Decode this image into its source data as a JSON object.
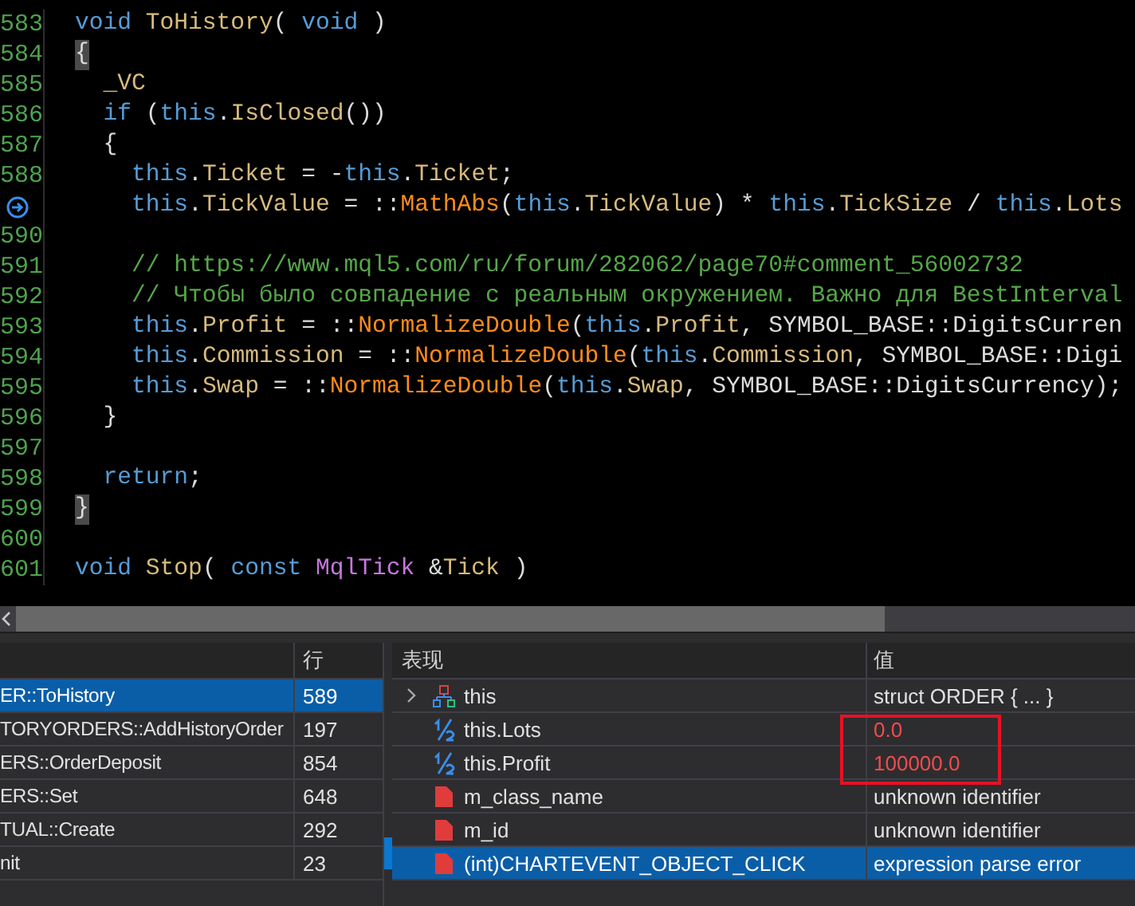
{
  "editor": {
    "lines": [
      {
        "number": "583",
        "current": false,
        "tokens": [
          {
            "kind": "keyword",
            "text": "void "
          },
          {
            "kind": "member",
            "text": "ToHistory"
          },
          {
            "kind": "plain",
            "text": "( "
          },
          {
            "kind": "keyword",
            "text": "void"
          },
          {
            "kind": "plain",
            "text": " )"
          }
        ]
      },
      {
        "number": "584",
        "current": false,
        "tokens": [
          {
            "kind": "brace",
            "text": "{"
          }
        ]
      },
      {
        "number": "585",
        "current": false,
        "tokens": [
          {
            "kind": "member",
            "text": "  _VC"
          }
        ]
      },
      {
        "number": "586",
        "current": false,
        "tokens": [
          {
            "kind": "keyword",
            "text": "  if"
          },
          {
            "kind": "plain",
            "text": " ("
          },
          {
            "kind": "keyword",
            "text": "this"
          },
          {
            "kind": "plain",
            "text": "."
          },
          {
            "kind": "member",
            "text": "IsClosed"
          },
          {
            "kind": "plain",
            "text": "())"
          }
        ]
      },
      {
        "number": "587",
        "current": false,
        "tokens": [
          {
            "kind": "plain",
            "text": "  {"
          }
        ]
      },
      {
        "number": "588",
        "current": false,
        "tokens": [
          {
            "kind": "keyword",
            "text": "    this"
          },
          {
            "kind": "plain",
            "text": "."
          },
          {
            "kind": "member",
            "text": "Ticket"
          },
          {
            "kind": "plain",
            "text": " = -"
          },
          {
            "kind": "keyword",
            "text": "this"
          },
          {
            "kind": "plain",
            "text": "."
          },
          {
            "kind": "member",
            "text": "Ticket"
          },
          {
            "kind": "plain",
            "text": ";"
          }
        ]
      },
      {
        "current": true,
        "tokens": [
          {
            "kind": "keyword",
            "text": "    this"
          },
          {
            "kind": "plain",
            "text": "."
          },
          {
            "kind": "member",
            "text": "TickValue"
          },
          {
            "kind": "plain",
            "text": " = ::"
          },
          {
            "kind": "function",
            "text": "MathAbs"
          },
          {
            "kind": "plain",
            "text": "("
          },
          {
            "kind": "keyword",
            "text": "this"
          },
          {
            "kind": "plain",
            "text": "."
          },
          {
            "kind": "member",
            "text": "TickValue"
          },
          {
            "kind": "plain",
            "text": ") * "
          },
          {
            "kind": "keyword",
            "text": "this"
          },
          {
            "kind": "plain",
            "text": "."
          },
          {
            "kind": "member",
            "text": "TickSize"
          },
          {
            "kind": "plain",
            "text": " / "
          },
          {
            "kind": "keyword",
            "text": "this"
          },
          {
            "kind": "plain",
            "text": "."
          },
          {
            "kind": "member",
            "text": "Lots"
          }
        ]
      },
      {
        "number": "590",
        "current": false
      },
      {
        "number": "591",
        "current": false,
        "tokens": [
          {
            "kind": "comment",
            "text": "    // https://www.mql5.com/ru/forum/282062/page70#comment_56002732"
          }
        ]
      },
      {
        "number": "592",
        "current": false,
        "tokens": [
          {
            "kind": "comment",
            "text": "    // Чтобы было совпадение с реальным окружением. Важно для BestInterval"
          }
        ]
      },
      {
        "number": "593",
        "current": false,
        "tokens": [
          {
            "kind": "keyword",
            "text": "    this"
          },
          {
            "kind": "plain",
            "text": "."
          },
          {
            "kind": "member",
            "text": "Profit"
          },
          {
            "kind": "plain",
            "text": " = ::"
          },
          {
            "kind": "function",
            "text": "NormalizeDouble"
          },
          {
            "kind": "plain",
            "text": "("
          },
          {
            "kind": "keyword",
            "text": "this"
          },
          {
            "kind": "plain",
            "text": "."
          },
          {
            "kind": "member",
            "text": "Profit"
          },
          {
            "kind": "plain",
            "text": ", SYMBOL_BASE::DigitsCurren"
          }
        ]
      },
      {
        "number": "594",
        "current": false,
        "tokens": [
          {
            "kind": "keyword",
            "text": "    this"
          },
          {
            "kind": "plain",
            "text": "."
          },
          {
            "kind": "member",
            "text": "Commission"
          },
          {
            "kind": "plain",
            "text": " = ::"
          },
          {
            "kind": "function",
            "text": "NormalizeDouble"
          },
          {
            "kind": "plain",
            "text": "("
          },
          {
            "kind": "keyword",
            "text": "this"
          },
          {
            "kind": "plain",
            "text": "."
          },
          {
            "kind": "member",
            "text": "Commission"
          },
          {
            "kind": "plain",
            "text": ", SYMBOL_BASE::Digi"
          }
        ]
      },
      {
        "number": "595",
        "current": false,
        "tokens": [
          {
            "kind": "keyword",
            "text": "    this"
          },
          {
            "kind": "plain",
            "text": "."
          },
          {
            "kind": "member",
            "text": "Swap"
          },
          {
            "kind": "plain",
            "text": " = ::"
          },
          {
            "kind": "function",
            "text": "NormalizeDouble"
          },
          {
            "kind": "plain",
            "text": "("
          },
          {
            "kind": "keyword",
            "text": "this"
          },
          {
            "kind": "plain",
            "text": "."
          },
          {
            "kind": "member",
            "text": "Swap"
          },
          {
            "kind": "plain",
            "text": ", SYMBOL_BASE::DigitsCurrency);"
          }
        ]
      },
      {
        "number": "596",
        "current": false,
        "tokens": [
          {
            "kind": "plain",
            "text": "  }"
          }
        ]
      },
      {
        "number": "597",
        "current": false
      },
      {
        "number": "598",
        "current": false,
        "tokens": [
          {
            "kind": "keyword",
            "text": "  return"
          },
          {
            "kind": "plain",
            "text": ";"
          }
        ]
      },
      {
        "number": "599",
        "current": false,
        "tokens": [
          {
            "kind": "brace",
            "text": "}"
          }
        ]
      },
      {
        "number": "600",
        "current": false
      },
      {
        "number": "601",
        "current": false,
        "tokens": [
          {
            "kind": "keyword",
            "text": "void "
          },
          {
            "kind": "member",
            "text": "Stop"
          },
          {
            "kind": "plain",
            "text": "( "
          },
          {
            "kind": "keyword",
            "text": "const "
          },
          {
            "kind": "type",
            "text": "MqlTick"
          },
          {
            "kind": "plain",
            "text": " &"
          },
          {
            "kind": "member",
            "text": "Tick"
          },
          {
            "kind": "plain",
            "text": " )"
          }
        ]
      }
    ]
  },
  "call_stack": {
    "columns": [
      "行"
    ],
    "rows": [
      {
        "function": "ER::ToHistory",
        "line": "589",
        "selected": true
      },
      {
        "function": "TORYORDERS::AddHistoryOrder",
        "line": "197",
        "selected": false
      },
      {
        "function": "ERS::OrderDeposit",
        "line": "854",
        "selected": false
      },
      {
        "function": "ERS::Set",
        "line": "648",
        "selected": false
      },
      {
        "function": "TUAL::Create",
        "line": "292",
        "selected": false
      },
      {
        "function": "nit",
        "line": "23",
        "selected": false
      }
    ]
  },
  "watch": {
    "columns": [
      "表现",
      "值"
    ],
    "rows": [
      {
        "kind": "struct",
        "expandable": true,
        "expression": "this",
        "value": "struct ORDER { ... }",
        "changed": false,
        "highlighted": false,
        "selected": false
      },
      {
        "kind": "number",
        "expandable": false,
        "expression": "this.Lots",
        "value": "0.0",
        "changed": true,
        "highlighted": true,
        "selected": false
      },
      {
        "kind": "number",
        "expandable": false,
        "expression": "this.Profit",
        "value": "100000.0",
        "changed": true,
        "highlighted": true,
        "selected": false
      },
      {
        "kind": "error",
        "expandable": false,
        "expression": "m_class_name",
        "value": "unknown identifier",
        "changed": false,
        "highlighted": false,
        "selected": false
      },
      {
        "kind": "error",
        "expandable": false,
        "expression": "m_id",
        "value": "unknown identifier",
        "changed": false,
        "highlighted": false,
        "selected": false
      },
      {
        "kind": "error",
        "expandable": false,
        "expression": "(int)CHARTEVENT_OBJECT_CLICK",
        "value": "expression parse error",
        "changed": false,
        "highlighted": false,
        "selected": true
      }
    ]
  }
}
